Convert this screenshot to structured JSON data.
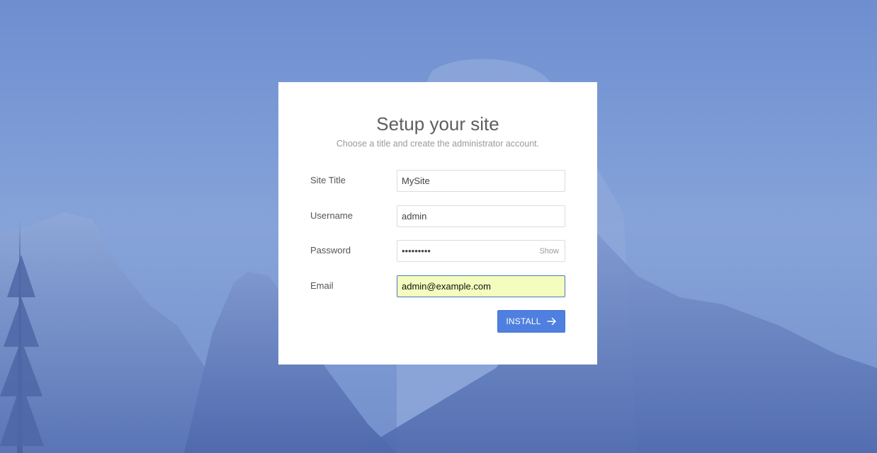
{
  "background": {
    "colors": {
      "sky": "#7d9bd6",
      "mountain": "#5b78b8",
      "accent": "#4f80e0"
    }
  },
  "setup": {
    "title": "Setup your site",
    "subtitle": "Choose a title and create the administrator account.",
    "fields": {
      "site_title": {
        "label": "Site Title",
        "value": "MySite"
      },
      "username": {
        "label": "Username",
        "value": "admin"
      },
      "password": {
        "label": "Password",
        "value": "•••••••••",
        "toggle_label": "Show"
      },
      "email": {
        "label": "Email",
        "value": "admin@example.com"
      }
    },
    "install_label": "INSTALL",
    "install_icon": "arrow-right-icon"
  }
}
